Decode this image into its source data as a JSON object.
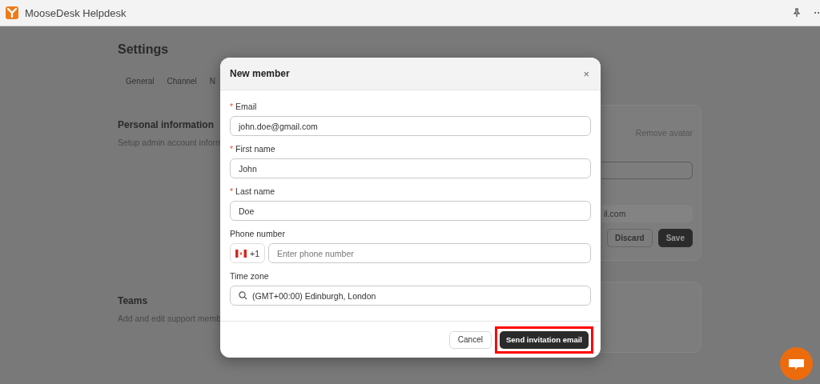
{
  "app": {
    "title": "MooseDesk Helpdesk"
  },
  "settings": {
    "title": "Settings",
    "tabs": [
      {
        "label": "General",
        "selected": false
      },
      {
        "label": "Channel",
        "selected": false
      },
      {
        "label": "N",
        "selected": false
      }
    ],
    "sections": [
      {
        "title": "Personal information",
        "description": "Setup admin account inform",
        "card": {
          "link": "Remove avatar",
          "email_value": "il.com",
          "buttons": [
            {
              "label": "Discard",
              "kind": "secondary"
            },
            {
              "label": "Save",
              "kind": "primary"
            }
          ]
        }
      },
      {
        "title": "Teams",
        "description": "Add and edit support memb"
      }
    ]
  },
  "dialog": {
    "title": "New member",
    "close": "×",
    "fields": [
      {
        "kind": "text",
        "required_mark": "*",
        "label": "Email",
        "value": "john.doe@gmail.com"
      },
      {
        "kind": "text",
        "required_mark": "*",
        "label": "First name",
        "value": "John"
      },
      {
        "kind": "text",
        "required_mark": "*",
        "label": "Last name",
        "value": "Doe"
      },
      {
        "kind": "phone",
        "label": "Phone number",
        "dial_code": "+1",
        "placeholder": "Enter phone number"
      },
      {
        "kind": "search",
        "label": "Time zone",
        "value": "(GMT+00:00) Edinburgh, London"
      }
    ],
    "buttons": [
      {
        "label": "Cancel",
        "kind": "secondary",
        "highlighted": false
      },
      {
        "label": "Send invitation email",
        "kind": "primary",
        "highlighted": true
      }
    ]
  }
}
